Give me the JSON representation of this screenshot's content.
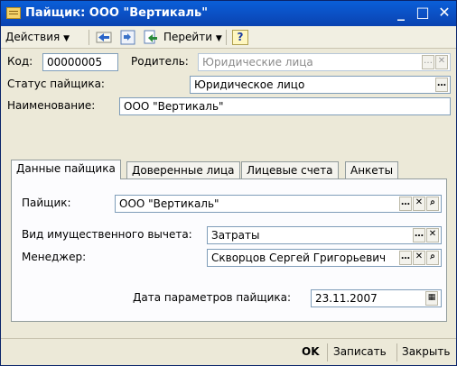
{
  "window": {
    "title": "Пайщик: ООО \"Вертикаль\""
  },
  "menubar": {
    "actions_label": "Действия",
    "goto_label": "Перейти",
    "help_label": "?"
  },
  "header": {
    "code_label": "Код:",
    "code_value": "00000005",
    "parent_label": "Родитель:",
    "parent_value": "Юридические лица",
    "status_label": "Статус пайщика:",
    "status_value": "Юридическое лицо",
    "name_label": "Наименование:",
    "name_value": "ООО \"Вертикаль\""
  },
  "tabs": [
    {
      "label": "Данные пайщика"
    },
    {
      "label": "Доверенные лица"
    },
    {
      "label": "Лицевые счета"
    },
    {
      "label": "Анкеты"
    }
  ],
  "panel": {
    "shareholder_label": "Пайщик:",
    "shareholder_value": "ООО \"Вертикаль\"",
    "deduction_label": "Вид имущественного вычета:",
    "deduction_value": "Затраты",
    "manager_label": "Менеджер:",
    "manager_value": "Скворцов Сергей Григорьевич",
    "date_label": "Дата параметров пайщика:",
    "date_value": "23.11.2007"
  },
  "footer": {
    "ok_label": "OK",
    "save_label": "Записать",
    "close_label": "Закрыть"
  },
  "colors": {
    "titlebar": "#0b4fc3",
    "window_bg": "#ece9d8",
    "field_border": "#7f9db9"
  }
}
